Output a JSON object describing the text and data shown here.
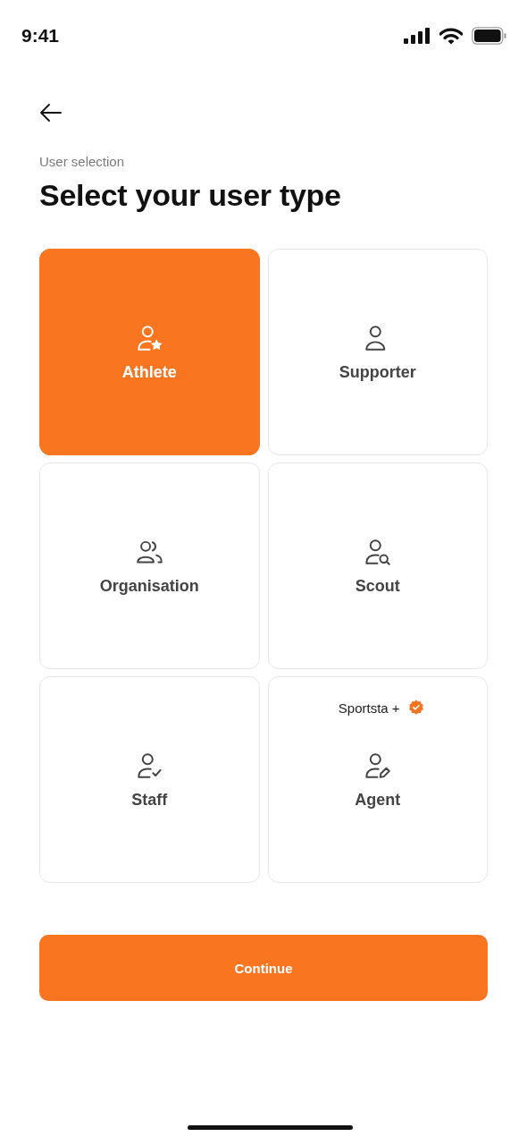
{
  "status_bar": {
    "time": "9:41"
  },
  "header": {
    "eyebrow": "User selection",
    "title": "Select your user type"
  },
  "options": [
    {
      "label": "Athlete",
      "selected": true
    },
    {
      "label": "Supporter",
      "selected": false
    },
    {
      "label": "Organisation",
      "selected": false
    },
    {
      "label": "Scout",
      "selected": false
    },
    {
      "label": "Staff",
      "selected": false
    },
    {
      "label": "Agent",
      "selected": false,
      "badge": "Sportsta +"
    }
  ],
  "continue_button": "Continue"
}
